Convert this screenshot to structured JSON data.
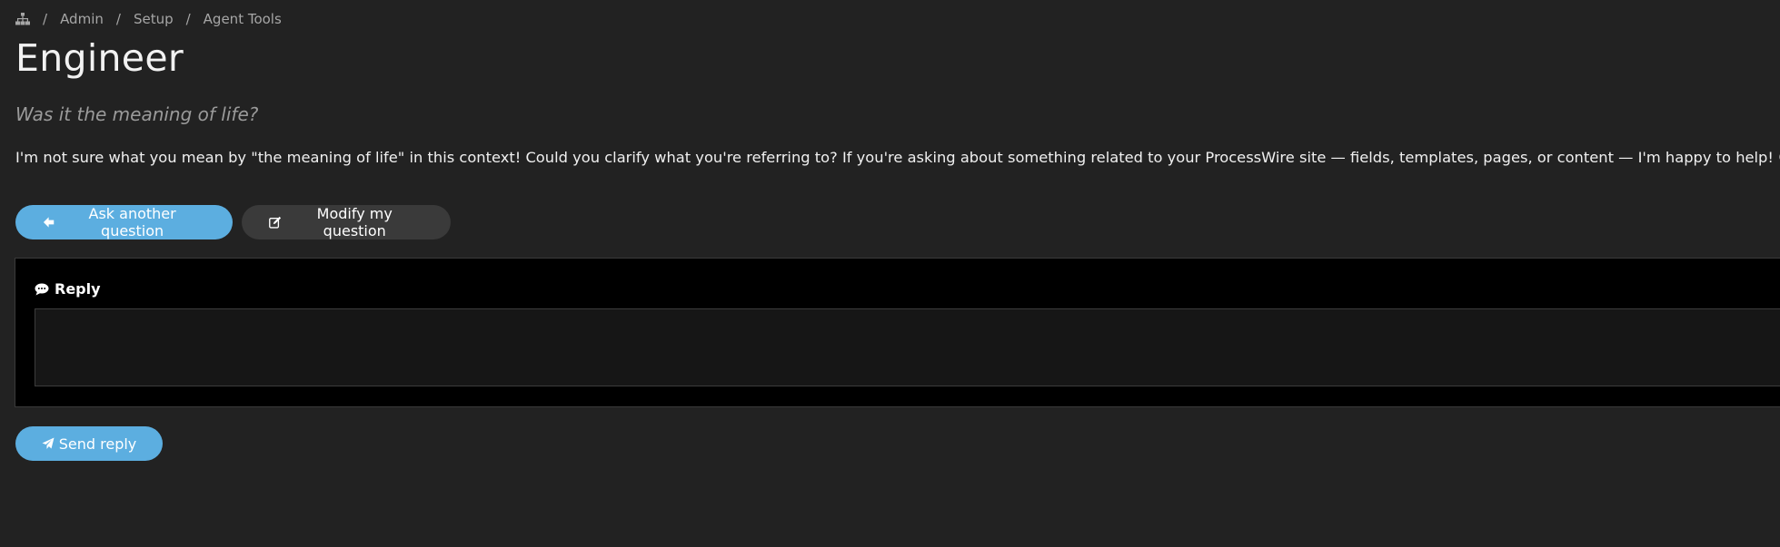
{
  "breadcrumb": {
    "home_icon": "sitemap-icon",
    "items": [
      "Admin",
      "Setup",
      "Agent Tools"
    ],
    "separator": "/"
  },
  "page": {
    "title": "Engineer",
    "question": "Was it the meaning of life?",
    "answer": "I'm not sure what you mean by \"the meaning of life\" in this context! Could you clarify what you're referring to? If you're asking about something related to your ProcessWire site — fields, templates, pages, or content — I'm happy to help! 😊"
  },
  "buttons": {
    "ask_another": "Ask another question",
    "modify": "Modify my question",
    "send": "Send reply"
  },
  "reply": {
    "label": "Reply",
    "value": ""
  },
  "colors": {
    "background": "#222222",
    "panel": "#000000",
    "primary": "#5caee0",
    "secondary": "#3a3a3a"
  }
}
